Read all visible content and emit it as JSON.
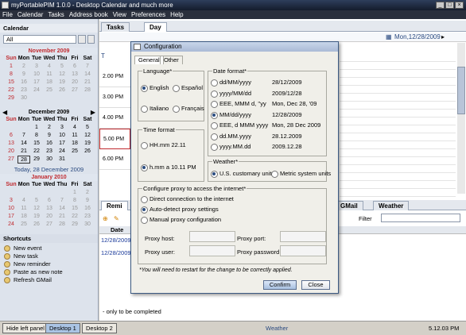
{
  "window": {
    "title": "myPortablePIM 1.0.0 - Desktop Calendar and much more"
  },
  "menu": [
    "File",
    "Calendar",
    "Tasks",
    "Address book",
    "View",
    "Preferences",
    "Help"
  ],
  "left": {
    "calendar_label": "Calendar",
    "filter_value": "All",
    "nov": {
      "title": "November 2009",
      "days": [
        "Sun",
        "Mon",
        "Tue",
        "Wed",
        "Thu",
        "Fri",
        "Sat"
      ],
      "rows": [
        [
          "1",
          "2",
          "3",
          "4",
          "5",
          "6",
          "7"
        ],
        [
          "8",
          "9",
          "10",
          "11",
          "12",
          "13",
          "14"
        ],
        [
          "15",
          "16",
          "17",
          "18",
          "19",
          "20",
          "21"
        ],
        [
          "22",
          "23",
          "24",
          "25",
          "26",
          "27",
          "28"
        ],
        [
          "29",
          "30",
          "",
          "",
          "",
          "",
          ""
        ]
      ]
    },
    "dec": {
      "title": "December 2009",
      "days": [
        "Sun",
        "Mon",
        "Tue",
        "Wed",
        "Thu",
        "Fri",
        "Sat"
      ],
      "rows": [
        [
          "",
          "",
          "1",
          "2",
          "3",
          "4",
          "5"
        ],
        [
          "6",
          "7",
          "8",
          "9",
          "10",
          "11",
          "12"
        ],
        [
          "13",
          "14",
          "15",
          "16",
          "17",
          "18",
          "19"
        ],
        [
          "20",
          "21",
          "22",
          "23",
          "24",
          "25",
          "26"
        ],
        [
          "27",
          "28",
          "29",
          "30",
          "31",
          "",
          ""
        ]
      ]
    },
    "today_label": "Today, 28 December 2009",
    "jan": {
      "title": "January 2010",
      "days": [
        "Sun",
        "Mon",
        "Tue",
        "Wed",
        "Thu",
        "Fri",
        "Sat"
      ],
      "rows": [
        [
          "",
          "",
          "",
          "",
          "",
          "1",
          "2"
        ],
        [
          "3",
          "4",
          "5",
          "6",
          "7",
          "8",
          "9"
        ],
        [
          "10",
          "11",
          "12",
          "13",
          "14",
          "15",
          "16"
        ],
        [
          "17",
          "18",
          "19",
          "20",
          "21",
          "22",
          "23"
        ],
        [
          "24",
          "25",
          "26",
          "27",
          "28",
          "29",
          "30"
        ]
      ]
    },
    "shortcuts_label": "Shortcuts",
    "shortcuts": [
      "New event",
      "New task",
      "New reminder",
      "Paste as new note",
      "Refresh GMail"
    ]
  },
  "main": {
    "tabs": [
      "Tasks",
      "Day"
    ],
    "date_display": "Mon,12/28/2009",
    "times": [
      "2.00 PM",
      "3.00 PM",
      "4.00 PM",
      "5.00 PM",
      "6.00 PM"
    ],
    "bottom_tabs": [
      "Remi",
      "GMail",
      "Weather"
    ],
    "date_col": "Date",
    "rows": [
      "12/28/2009",
      "12/28/2009"
    ],
    "filter_label": "Filter",
    "footer_text": "- only to be completed"
  },
  "status": {
    "hide_left": "Hide left panel",
    "desktop1": "Desktop 1",
    "desktop2": "Desktop 2",
    "weather": "Weather",
    "clock": "5.12.03 PM"
  },
  "dialog": {
    "title": "Configuration",
    "tabs": [
      "General",
      "Other"
    ],
    "language_label": "Language*",
    "languages": [
      "English",
      "Español",
      "Italiano",
      "Français"
    ],
    "time_label": "Time format",
    "time_options": [
      "HH.mm 22.11",
      "h.mm a 10.11 PM"
    ],
    "date_label": "Date format*",
    "date_formats": [
      [
        "dd/MM/yyyy",
        "28/12/2009"
      ],
      [
        "yyyy/MM/dd",
        "2009/12/28"
      ],
      [
        "EEE, MMM d, ''yy",
        "Mon, Dec 28, '09"
      ],
      [
        "MM/dd/yyyy",
        "12/28/2009"
      ],
      [
        "EEE, d MMM yyyy",
        "Mon, 28 Dec 2009"
      ],
      [
        "dd.MM.yyyy",
        "28.12.2009"
      ],
      [
        "yyyy.MM.dd",
        "2009.12.28"
      ]
    ],
    "weather_label": "Weather*",
    "weather_options": [
      "U.S. customary units",
      "Metric system units"
    ],
    "proxy_label": "Configure proxy to access the internet*",
    "proxy_options": [
      "Direct connection to the internet",
      "Auto-detect proxy settings",
      "Manual proxy configuration"
    ],
    "proxy_host": "Proxy host:",
    "proxy_port": "Proxy port:",
    "proxy_user": "Proxy user:",
    "proxy_password": "Proxy password:",
    "note": "*You will need to restart for the change to be correctly applied.",
    "confirm": "Confirm",
    "close": "Close"
  }
}
